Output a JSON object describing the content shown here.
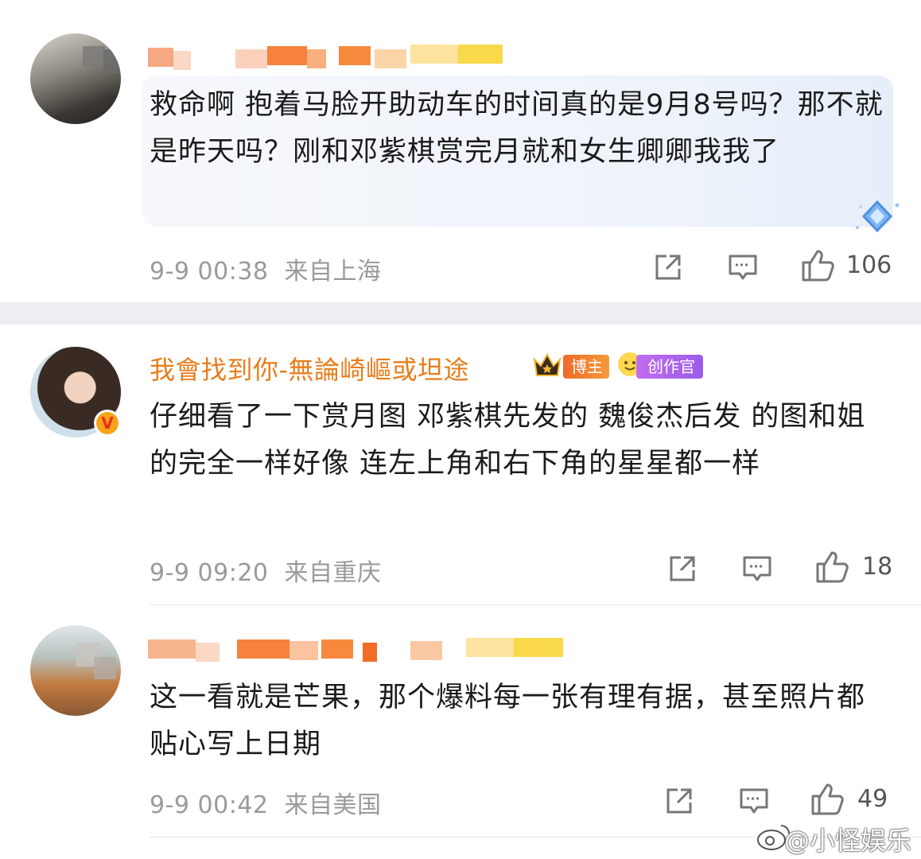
{
  "comments": [
    {
      "text": "救命啊 抱着马脸开助动车的时间真的是9月8号吗？那不就是昨天吗？刚和邓紫棋赏完月就和女生卿卿我我了",
      "time": "9-9 00:38",
      "location": "来自上海",
      "likes": "106"
    },
    {
      "username": "我會找到你-無論崎嶇或坦途",
      "badges": [
        "博主",
        "创作官"
      ],
      "text": "仔细看了一下赏月图 邓紫棋先发的 魏俊杰后发 的图和姐的完全一样好像 连左上角和右下角的星星都一样",
      "time": "9-9 09:20",
      "location": "来自重庆",
      "likes": "18"
    },
    {
      "text": "这一看就是芒果，那个爆料每一张有理有据，甚至照片都贴心写上日期",
      "time": "9-9 00:42",
      "location": "来自美国",
      "likes": "49"
    }
  ],
  "watermark": "@小怪娱乐",
  "colors": {
    "username": "#e77d1b",
    "meta": "#9a9a9a",
    "tag_blogger": "#f06a2a",
    "tag_creator": "#9b5be8"
  },
  "icons": [
    "share-icon",
    "comment-icon",
    "thumbs-up-icon",
    "weibo-logo-icon"
  ]
}
